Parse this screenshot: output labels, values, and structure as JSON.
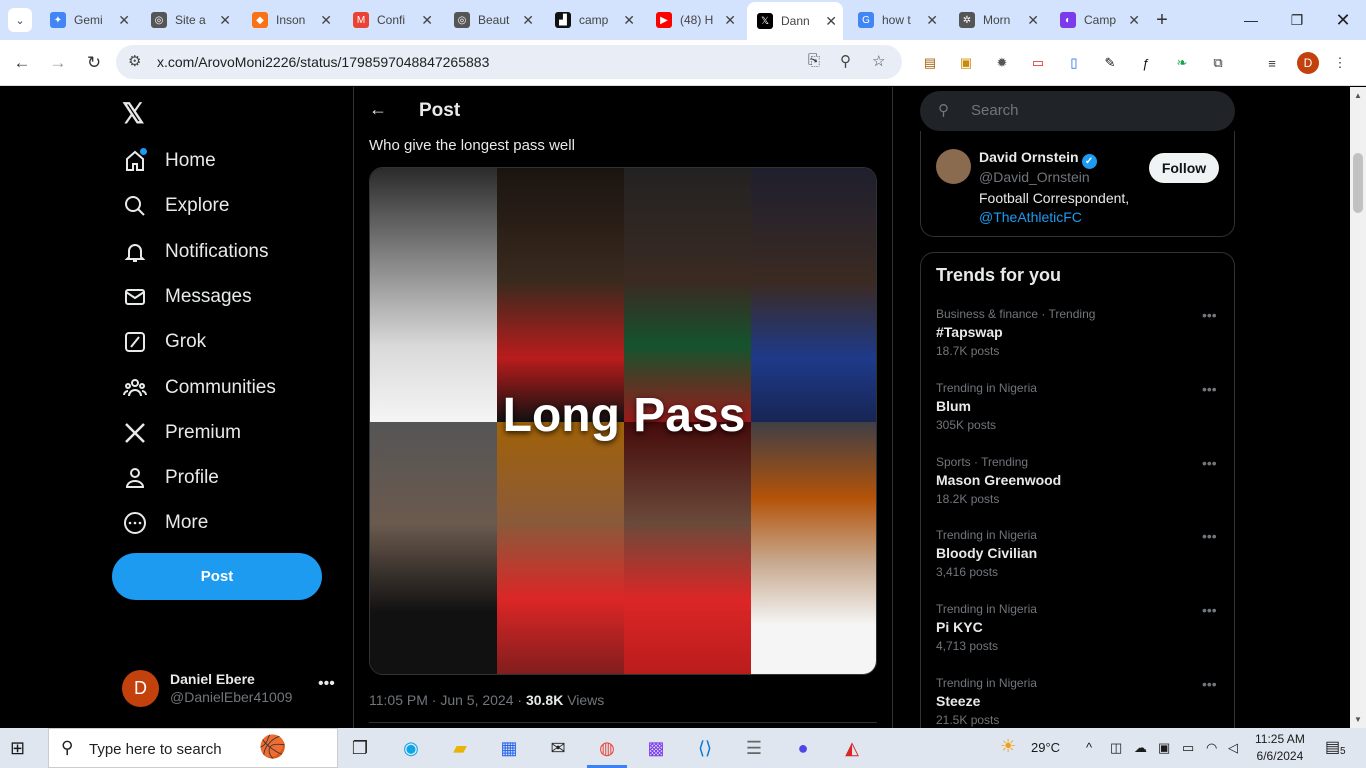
{
  "browser": {
    "tabs": [
      {
        "label": "Gemi",
        "color": "#4285f4",
        "glyph": "✦"
      },
      {
        "label": "Site a",
        "color": "#555555",
        "glyph": "◎"
      },
      {
        "label": "Inson",
        "color": "#f97316",
        "glyph": "◆"
      },
      {
        "label": "Confi",
        "color": "#ea4335",
        "glyph": "M"
      },
      {
        "label": "Beaut",
        "color": "#555555",
        "glyph": "◎"
      },
      {
        "label": "camp",
        "color": "#111111",
        "glyph": "▟"
      },
      {
        "label": "(48) H",
        "color": "#ff0000",
        "glyph": "▶"
      },
      {
        "label": "Dann",
        "color": "#000000",
        "glyph": "𝕏"
      },
      {
        "label": "how t",
        "color": "#4285f4",
        "glyph": "G"
      },
      {
        "label": "Morn",
        "color": "#555555",
        "glyph": "✲"
      },
      {
        "label": "Camp",
        "color": "#7c3aed",
        "glyph": "◐"
      }
    ],
    "url": "x.com/ArovoMoni2226/status/1798597048847265883",
    "profile_initial": "D"
  },
  "sidebar": {
    "logo": "𝕏",
    "items": [
      {
        "label": "Home",
        "icon": "home-icon"
      },
      {
        "label": "Explore",
        "icon": "search-icon"
      },
      {
        "label": "Notifications",
        "icon": "bell-icon"
      },
      {
        "label": "Messages",
        "icon": "mail-icon"
      },
      {
        "label": "Grok",
        "icon": "grok-icon"
      },
      {
        "label": "Communities",
        "icon": "communities-icon"
      },
      {
        "label": "Premium",
        "icon": "x-premium-icon"
      },
      {
        "label": "Profile",
        "icon": "person-icon"
      },
      {
        "label": "More",
        "icon": "more-circle-icon"
      }
    ],
    "post_button": "Post",
    "user": {
      "initial": "D",
      "name": "Daniel Ebere",
      "handle": "@DanielEber41009"
    }
  },
  "post": {
    "header": "Post",
    "text": "Who give  the longest pass well",
    "media_caption": "Long Pass",
    "time": "11:05 PM · Jun 5, 2024 · ",
    "views_count": "30.8K",
    "views_label": " Views"
  },
  "right": {
    "search_placeholder": "Search",
    "who": {
      "name": "David Ornstein",
      "handle": "@David_Ornstein",
      "bio": "Football Correspondent,",
      "link": "@TheAthleticFC",
      "follow": "Follow"
    },
    "trends_title": "Trends for you",
    "trends": [
      {
        "context": "Business & finance · Trending",
        "name": "#Tapswap",
        "count": "18.7K posts"
      },
      {
        "context": "Trending in Nigeria",
        "name": "Blum",
        "count": "305K posts"
      },
      {
        "context": "Sports · Trending",
        "name": "Mason Greenwood",
        "count": "18.2K posts"
      },
      {
        "context": "Trending in Nigeria",
        "name": "Bloody Civilian",
        "count": "3,416 posts"
      },
      {
        "context": "Trending in Nigeria",
        "name": "Pi KYC",
        "count": "4,713 posts"
      },
      {
        "context": "Trending in Nigeria",
        "name": "Steeze",
        "count": "21.5K posts"
      }
    ]
  },
  "taskbar": {
    "search_placeholder": "Type here to search",
    "weather": "29°C",
    "time": "11:25 AM",
    "date": "6/6/2024",
    "notifications": "5"
  }
}
